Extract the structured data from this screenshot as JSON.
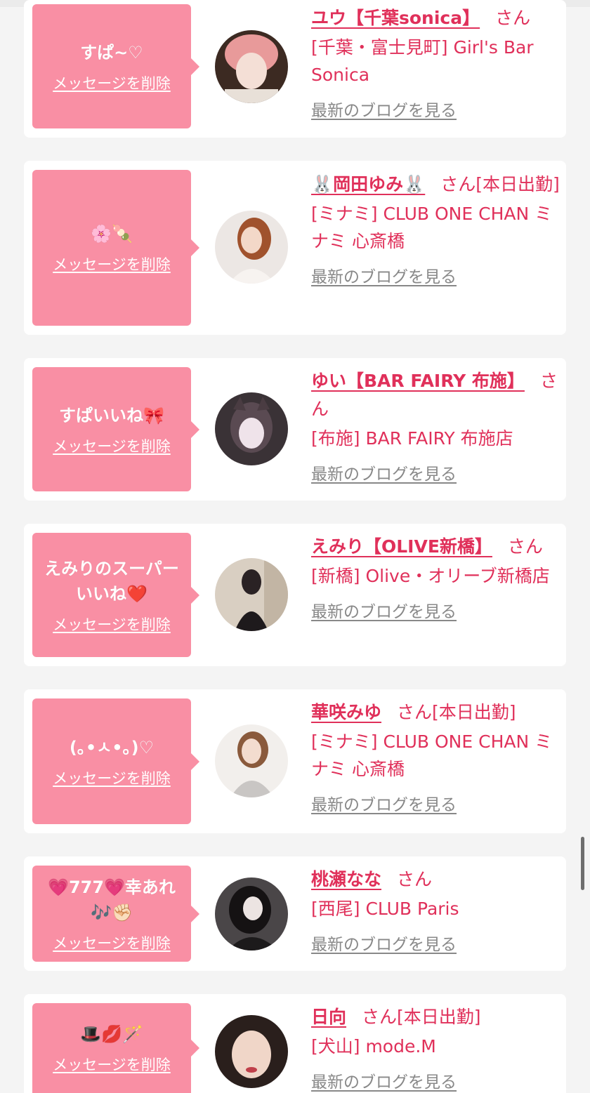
{
  "common": {
    "delete_label": "メッセージを削除",
    "blog_label": "最新のブログを見る",
    "san": "さん"
  },
  "cards": [
    {
      "message": "すぱ~♡",
      "name": "ユウ【千葉sonica】",
      "status": "",
      "shop": "[千葉・富士見町] Girl's Bar Sonica"
    },
    {
      "message": "🌸🍡",
      "name": "🐰岡田ゆみ🐰",
      "status": "[本日出勤]",
      "shop": "[ミナミ] CLUB ONE CHAN ミナミ 心斎橋"
    },
    {
      "message": "すぱいいね🎀",
      "name": "ゆい【BAR FAIRY 布施】",
      "status": "",
      "shop": "[布施] BAR FAIRY 布施店"
    },
    {
      "message": "えみりのスーパーいいね❤️",
      "name": "えみり【OLIVE新橋】",
      "status": "",
      "shop": "[新橋] Olive・オリーブ新橋店"
    },
    {
      "message": "(｡•ㅅ•｡)♡",
      "name": "華咲みゆ",
      "status": "[本日出勤]",
      "shop": "[ミナミ] CLUB ONE CHAN ミナミ 心斎橋"
    },
    {
      "message": "💗777💗幸あれ🎶✊🏻",
      "name": "桃瀬なな",
      "status": "",
      "shop": "[西尾] CLUB Paris"
    },
    {
      "message": "🎩💋🪄",
      "name": "日向",
      "status": "[本日出勤]",
      "shop": "[犬山] mode.M"
    }
  ],
  "colors": {
    "accent": "#e0305a",
    "message_bg": "#f98fa4",
    "page_bg": "#f4f4f4",
    "card_bg": "#ffffff",
    "link_gray": "#888888"
  }
}
